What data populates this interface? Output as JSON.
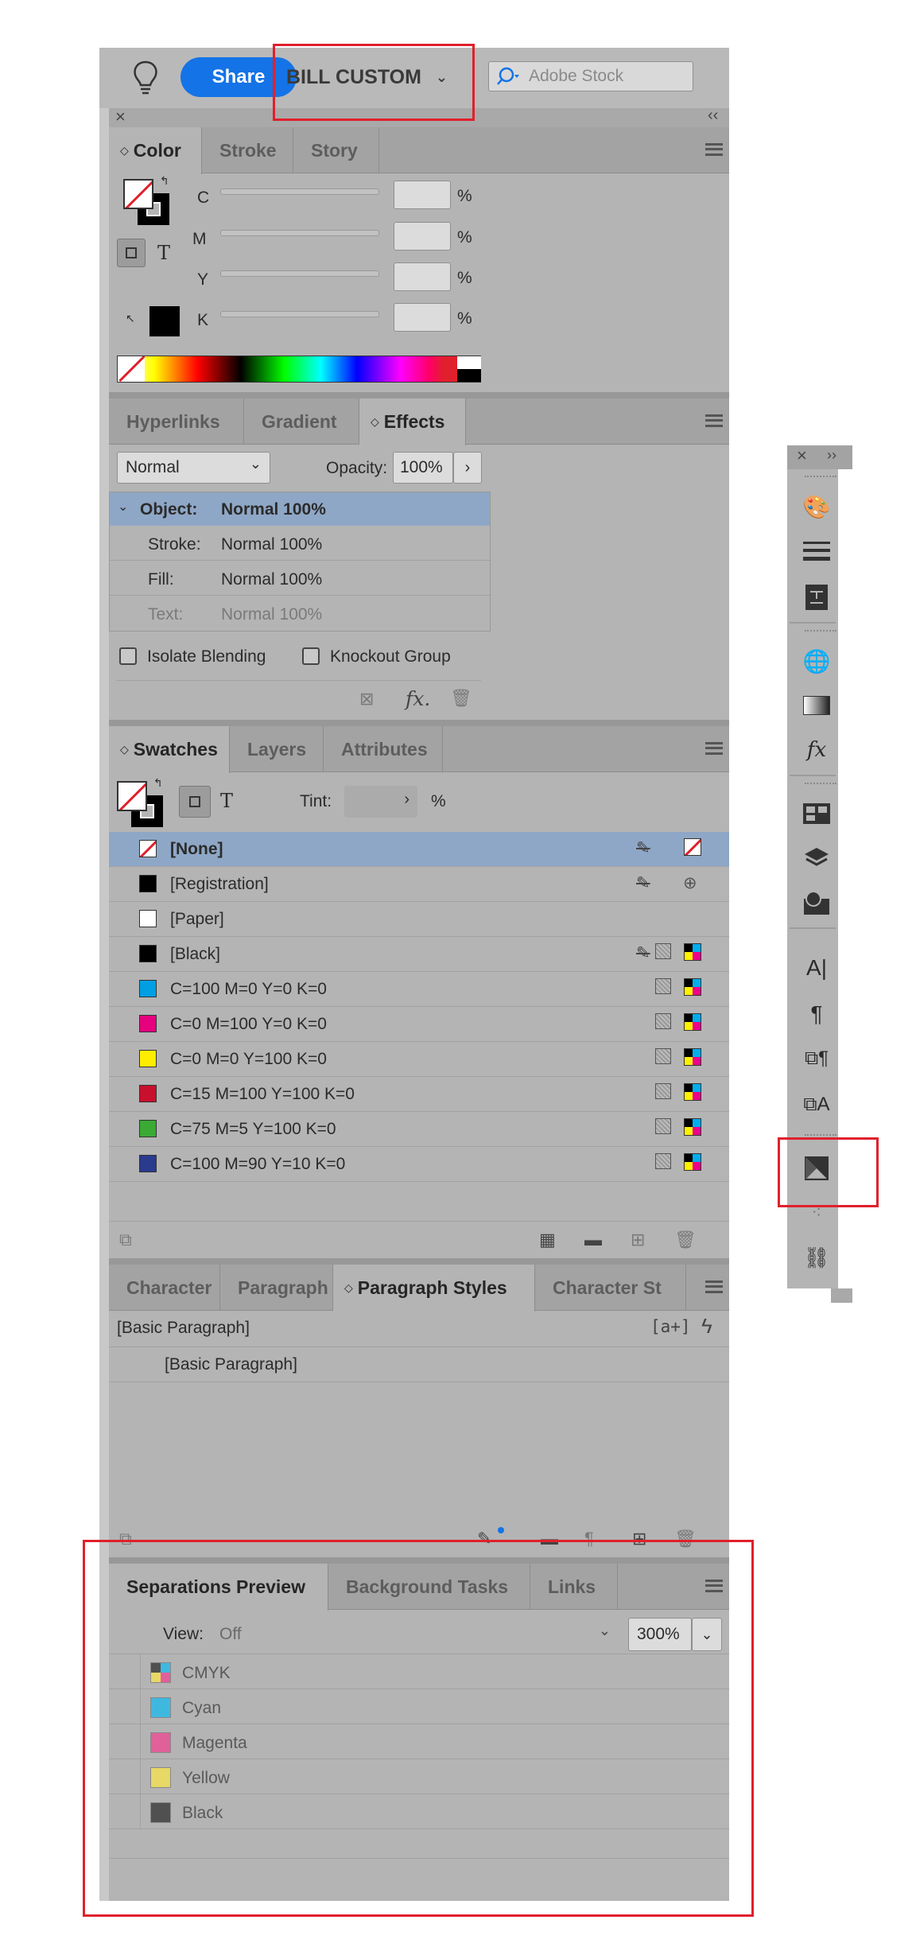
{
  "appbar": {
    "share_label": "Share",
    "workspace_label": "BILL CUSTOM",
    "stock_placeholder": "Adobe Stock"
  },
  "color_panel": {
    "tabs": [
      "Color",
      "Stroke",
      "Story"
    ],
    "channels": [
      {
        "label": "C",
        "value": "",
        "unit": "%"
      },
      {
        "label": "M",
        "value": "",
        "unit": "%"
      },
      {
        "label": "Y",
        "value": "",
        "unit": "%"
      },
      {
        "label": "K",
        "value": "",
        "unit": "%"
      }
    ],
    "text_toggle": "T"
  },
  "effects_panel": {
    "tabs": [
      "Hyperlinks",
      "Gradient",
      "Effects"
    ],
    "blend_mode": "Normal",
    "opacity_label": "Opacity:",
    "opacity_value": "100%",
    "targets": [
      {
        "label": "Object:",
        "value": "Normal 100%"
      },
      {
        "label": "Stroke:",
        "value": "Normal 100%"
      },
      {
        "label": "Fill:",
        "value": "Normal 100%"
      },
      {
        "label": "Text:",
        "value": "Normal 100%"
      }
    ],
    "isolate_blending": "Isolate Blending",
    "knockout_group": "Knockout Group",
    "fx_label": "fx."
  },
  "swatches_panel": {
    "tabs": [
      "Swatches",
      "Layers",
      "Attributes"
    ],
    "tint_label": "Tint:",
    "tint_unit": "%",
    "text_toggle": "T",
    "swatches": [
      {
        "name": "[None]",
        "color": "none"
      },
      {
        "name": "[Registration]",
        "color": "#000000"
      },
      {
        "name": "[Paper]",
        "color": "#ffffff"
      },
      {
        "name": "[Black]",
        "color": "#000000"
      },
      {
        "name": "C=100 M=0 Y=0 K=0",
        "color": "#009fe3"
      },
      {
        "name": "C=0 M=100 Y=0 K=0",
        "color": "#e5007e"
      },
      {
        "name": "C=0 M=0 Y=100 K=0",
        "color": "#ffed00"
      },
      {
        "name": "C=15 M=100 Y=100 K=0",
        "color": "#c8102e"
      },
      {
        "name": "C=75 M=5 Y=100 K=0",
        "color": "#3aaa35"
      },
      {
        "name": "C=100 M=90 Y=10 K=0",
        "color": "#2a3a8c"
      }
    ]
  },
  "styles_panel": {
    "tabs": [
      "Character",
      "Paragraph",
      "Paragraph Styles",
      "Character St"
    ],
    "current_style": "[Basic Paragraph]",
    "quick_apply": "[a+]",
    "styles": [
      "[Basic Paragraph]"
    ]
  },
  "separations_panel": {
    "tabs": [
      "Separations Preview",
      "Background Tasks",
      "Links"
    ],
    "view_label": "View:",
    "view_value": "Off",
    "zoom_value": "300%",
    "plates": [
      {
        "name": "CMYK",
        "color": "cmyk"
      },
      {
        "name": "Cyan",
        "color": "#3fb8e0"
      },
      {
        "name": "Magenta",
        "color": "#e0609a"
      },
      {
        "name": "Yellow",
        "color": "#e8d865"
      },
      {
        "name": "Black",
        "color": "#505050"
      }
    ]
  },
  "colors": {
    "accent": "#1473e6",
    "highlight": "#e0202c",
    "selection": "#8fa7c6"
  }
}
